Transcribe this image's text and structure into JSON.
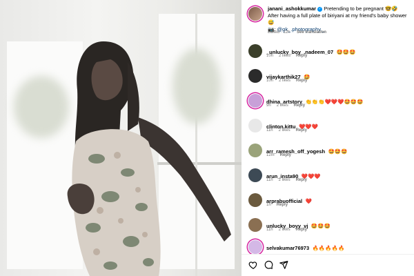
{
  "post": {
    "image_alt": "woman silhouette photo",
    "caption": {
      "username": "janani_ashokkumar",
      "verified": true,
      "line1": "Pretending to be pregnant 🤓🤣",
      "line2": "After having a full plate of biriyani at my friend's baby shower 😅",
      "line3_icon": "📷:",
      "line3_link": "@gk_.photography._",
      "edited": "Edited · 12h",
      "see_translation": "See translation"
    }
  },
  "comments": [
    {
      "username": "_unlucky_boy_.nadeem_07",
      "text": "🤩🤩🤩",
      "time": "10h",
      "likes": "2 likes",
      "reply": "Reply"
    },
    {
      "username": "vijaykarthik27",
      "text": "🤩",
      "time": "10h",
      "likes": "2 likes",
      "reply": "Reply"
    },
    {
      "username": "dhina_artstory",
      "text": "👏👏👏❤️❤️❤️🤩🤩🤩",
      "time": "9h",
      "likes": "2 likes",
      "reply": "Reply"
    },
    {
      "username": "clinton.kittu",
      "text": "❤️❤️❤️",
      "time": "11h",
      "likes": "2 likes",
      "reply": "Reply"
    },
    {
      "username": "arr_ramesh_off_yogesh",
      "text": "🤩🤩🤩",
      "time": "12m",
      "likes": "",
      "reply": "Reply"
    },
    {
      "username": "arun_insta90",
      "text": "❤️❤️❤️",
      "time": "11h",
      "likes": "2 likes",
      "reply": "Reply"
    },
    {
      "username": "arprabuofficial",
      "text": "❤️",
      "time": "1h",
      "likes": "",
      "reply": "Reply"
    },
    {
      "username": "unlucky_boyy_vj",
      "text": "🤩🤩🤩",
      "time": "11h",
      "likes": "2 likes",
      "reply": "Reply"
    },
    {
      "username": "selvakumar76973",
      "text": "🔥🔥🔥🔥🔥",
      "time": "",
      "likes": "",
      "reply": ""
    }
  ],
  "actions": {
    "like": "heart-icon",
    "comment": "comment-icon",
    "share": "share-icon"
  },
  "colors": {
    "link": "#00376b",
    "verified": "#0095f6",
    "meta": "#737373"
  }
}
